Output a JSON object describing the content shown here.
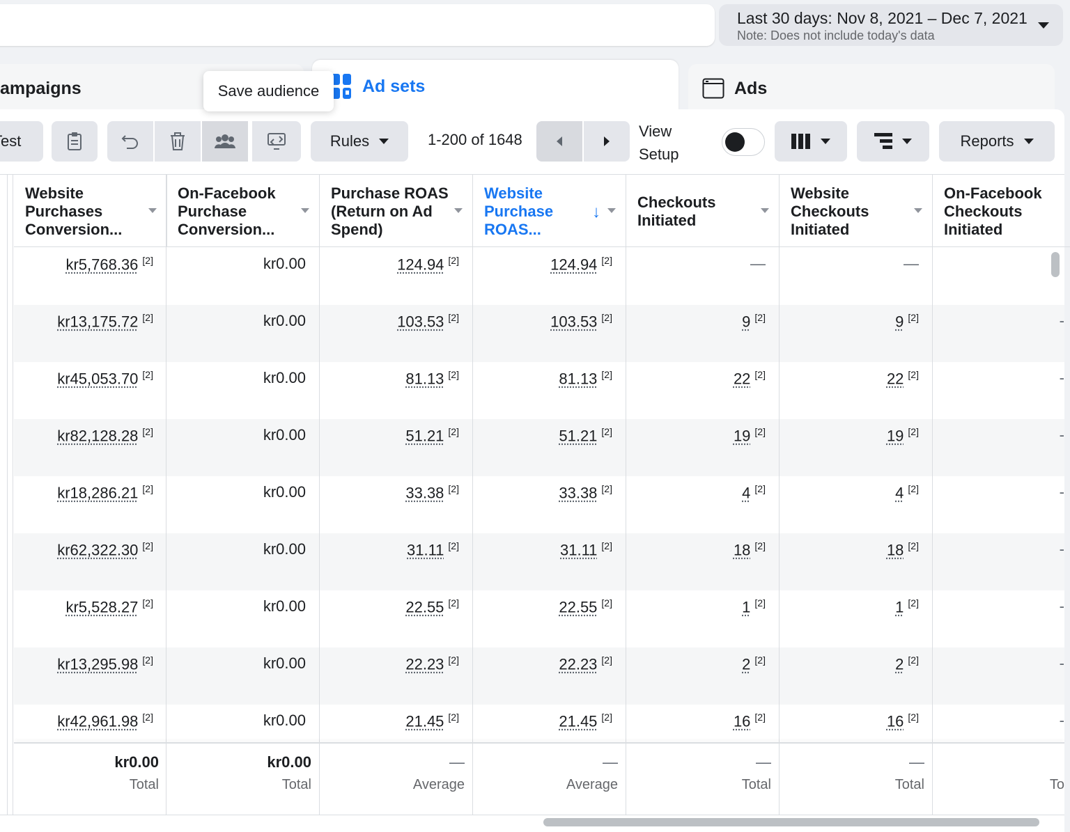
{
  "date_range": {
    "label": "Last 30 days: Nov 8, 2021 – Dec 7, 2021",
    "note": "Note: Does not include today's data"
  },
  "tabs": {
    "campaigns": "ampaigns",
    "adsets": "Ad sets",
    "ads": "Ads"
  },
  "tooltip": "Save audience",
  "toolbar": {
    "test_label": "Test",
    "rules_label": "Rules",
    "pagination": "1-200 of 1648",
    "view_setup_line1": "View",
    "view_setup_line2": "Setup",
    "reports_label": "Reports"
  },
  "columns": [
    "Website Purchases Conversion...",
    "On-Facebook Purchase Conversion...",
    "Purchase ROAS (Return on Ad Spend)",
    "Website Purchase ROAS...",
    "Checkouts Initiated",
    "Website Checkouts Initiated",
    "On-Facebook Checkouts Initiated"
  ],
  "footnote": "[2]",
  "rows": [
    [
      "kr5,768.36",
      "kr0.00",
      "124.94",
      "124.94",
      "—",
      "—",
      ""
    ],
    [
      "kr13,175.72",
      "kr0.00",
      "103.53",
      "103.53",
      "9",
      "9",
      "-"
    ],
    [
      "kr45,053.70",
      "kr0.00",
      "81.13",
      "81.13",
      "22",
      "22",
      "-"
    ],
    [
      "kr82,128.28",
      "kr0.00",
      "51.21",
      "51.21",
      "19",
      "19",
      "-"
    ],
    [
      "kr18,286.21",
      "kr0.00",
      "33.38",
      "33.38",
      "4",
      "4",
      "-"
    ],
    [
      "kr62,322.30",
      "kr0.00",
      "31.11",
      "31.11",
      "18",
      "18",
      "-"
    ],
    [
      "kr5,528.27",
      "kr0.00",
      "22.55",
      "22.55",
      "1",
      "1",
      "-"
    ],
    [
      "kr13,295.98",
      "kr0.00",
      "22.23",
      "22.23",
      "2",
      "2",
      "-"
    ],
    [
      "kr42,961.98",
      "kr0.00",
      "21.45",
      "21.45",
      "16",
      "16",
      "-"
    ]
  ],
  "footer": [
    {
      "value": "kr0.00",
      "label": "Total"
    },
    {
      "value": "kr0.00",
      "label": "Total"
    },
    {
      "value": "—",
      "label": "Average"
    },
    {
      "value": "—",
      "label": "Average"
    },
    {
      "value": "—",
      "label": "Total"
    },
    {
      "value": "—",
      "label": "Total"
    },
    {
      "value": "",
      "label": "To"
    }
  ],
  "colors": {
    "accent": "#1877f2",
    "toolbar_button": "#e4e6eb",
    "alt_row": "#f5f6f7"
  }
}
